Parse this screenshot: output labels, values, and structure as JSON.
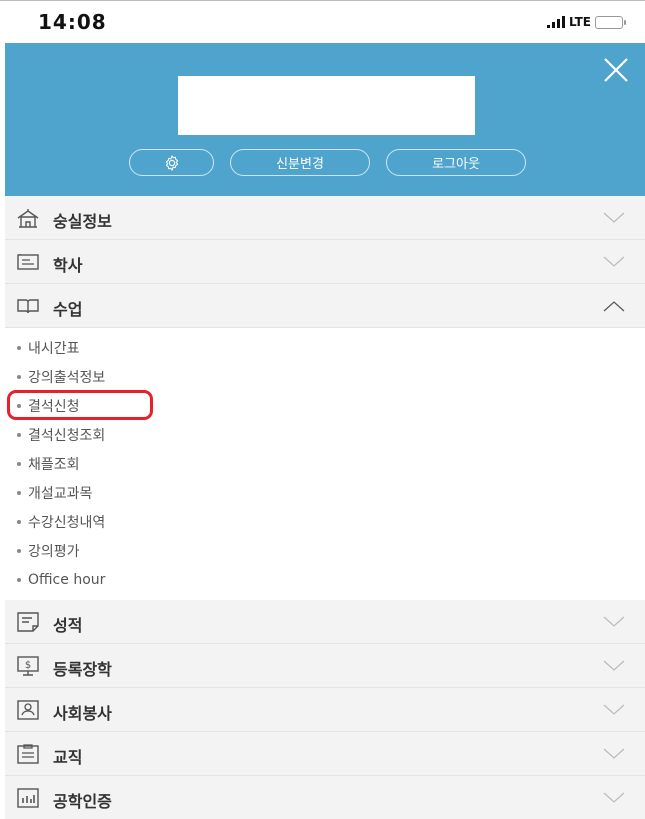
{
  "status_bar": {
    "time": "14:08",
    "network": "LTE",
    "signal_icon": "signal-bars-icon",
    "battery_icon": "battery-icon"
  },
  "header": {
    "close_icon": "close-icon",
    "settings_icon": "gear-icon",
    "buttons": {
      "change_identity": "신분변경",
      "logout": "로그아웃"
    },
    "background_color": "#4fa4cd"
  },
  "menu": {
    "items": [
      {
        "label": "숭실정보",
        "icon": "school-building-icon",
        "expanded": false
      },
      {
        "label": "학사",
        "icon": "id-card-icon",
        "expanded": false
      },
      {
        "label": "수업",
        "icon": "open-book-icon",
        "expanded": true
      },
      {
        "label": "성적",
        "icon": "document-icon",
        "expanded": false
      },
      {
        "label": "등록장학",
        "icon": "money-monitor-icon",
        "expanded": false
      },
      {
        "label": "사회봉사",
        "icon": "person-card-icon",
        "expanded": false
      },
      {
        "label": "교직",
        "icon": "clipboard-icon",
        "expanded": false
      },
      {
        "label": "공학인증",
        "icon": "bar-chart-icon",
        "expanded": false
      }
    ],
    "submenu": [
      "내시간표",
      "강의출석정보",
      "결석신청",
      "결석신청조회",
      "채플조회",
      "개설교과목",
      "수강신청내역",
      "강의평가",
      "Office hour"
    ],
    "highlighted_item": "결석신청",
    "highlight_color": "#e8202a"
  }
}
